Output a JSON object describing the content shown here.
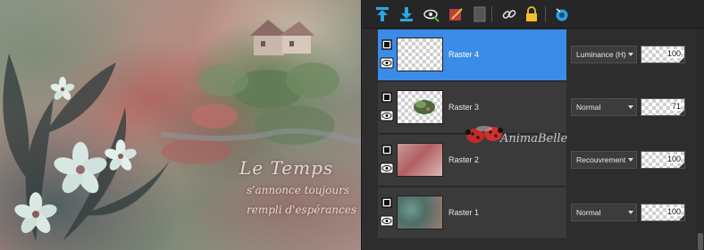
{
  "artwork": {
    "caption_line1": "Le Temps",
    "caption_line2": "s'annonce toujours",
    "caption_line3": "rempli d'espérances"
  },
  "toolbar": {
    "buttons": [
      {
        "icon": "move-layer-up-icon"
      },
      {
        "icon": "move-layer-down-icon"
      },
      {
        "icon": "visibility-toggle-icon"
      },
      {
        "icon": "layer-edit-icon"
      },
      {
        "icon": "layer-mask-icon"
      },
      {
        "icon": "link-icon"
      },
      {
        "icon": "lock-icon"
      },
      {
        "icon": "blend-ranges-icon"
      }
    ]
  },
  "layers": [
    {
      "name": "Raster 4",
      "blend_mode": "Luminance (H)",
      "opacity": "100",
      "selected": true
    },
    {
      "name": "Raster 3",
      "blend_mode": "Normal",
      "opacity": "71",
      "selected": false
    },
    {
      "name": "Raster 2",
      "blend_mode": "Recouvrement",
      "opacity": "100",
      "selected": false
    },
    {
      "name": "Raster 1",
      "blend_mode": "Normal",
      "opacity": "100",
      "selected": false
    }
  ],
  "watermark": {
    "text": "AnimaBelle"
  },
  "colors": {
    "selected_row": "#3a8ce8",
    "panel_bg": "#2d2d2d",
    "accent_icon": "#29a3e0"
  }
}
